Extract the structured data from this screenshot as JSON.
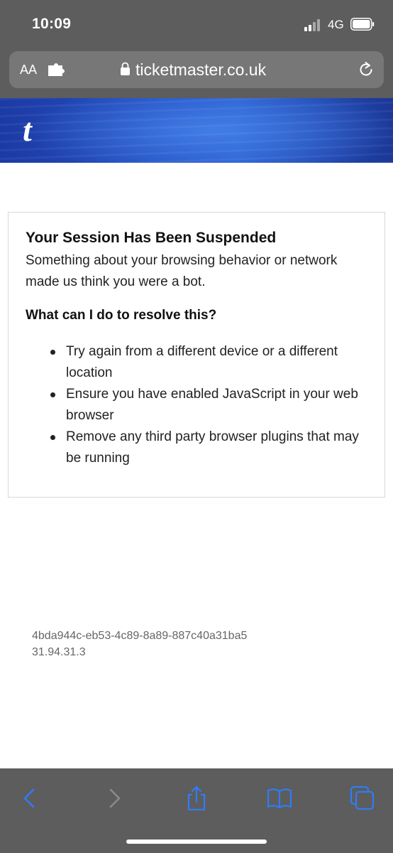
{
  "status_bar": {
    "time": "10:09",
    "network": "4G"
  },
  "address_bar": {
    "text_size_label": "AA",
    "url": "ticketmaster.co.uk"
  },
  "site": {
    "logo": "t",
    "brand_color": "#1f45b3"
  },
  "message": {
    "title": "Your Session Has Been Suspended",
    "description": "Something about your browsing behavior or network made us think you were a bot.",
    "subtitle": "What can I do to resolve this?",
    "steps": [
      "Try again from a different device or a different location",
      "Ensure you have enabled JavaScript in your web browser",
      "Remove any third party browser plugins that may be running"
    ]
  },
  "reference": {
    "session_id": "4bda944c-eb53-4c89-8a89-887c40a31ba5",
    "ip": "31.94.31.3"
  },
  "toolbar": {
    "icons": [
      "back-icon",
      "forward-icon",
      "share-icon",
      "bookmarks-icon",
      "tabs-icon"
    ],
    "accent_color": "#2f7cf6",
    "disabled_color": "#8a8a8a"
  }
}
